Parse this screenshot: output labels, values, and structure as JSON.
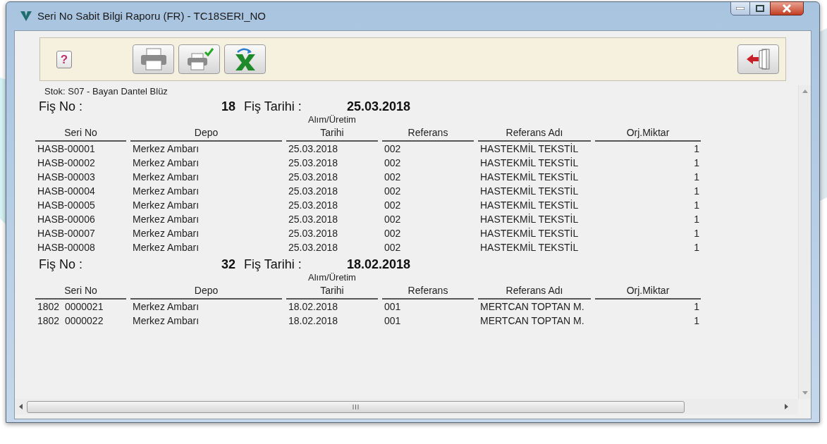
{
  "window": {
    "title": "Seri No Sabit Bilgi Raporu (FR) - TC18SERI_NO"
  },
  "toolbar": [
    {
      "kind": "help",
      "label": "?"
    },
    {
      "kind": "print"
    },
    {
      "kind": "print-check"
    },
    {
      "kind": "excel"
    },
    {
      "kind": "exit"
    }
  ],
  "report": {
    "stock": "Stok: S07 - Bayan Dantel Blüz",
    "groups": [
      {
        "fis_no_label": "Fiş No :",
        "fis_no": "18",
        "fis_tarihi_label": "Fiş Tarihi :",
        "fis_tarihi": "25.03.2018",
        "columns": [
          {
            "label": "Seri No",
            "kind": "text"
          },
          {
            "label": "Depo",
            "kind": "text"
          },
          {
            "over": "Alım/Üretim",
            "label": "Tarihi",
            "kind": "text"
          },
          {
            "label": "Referans",
            "kind": "text"
          },
          {
            "label": "Referans Adı",
            "kind": "text"
          },
          {
            "label": "Orj.Miktar",
            "kind": "number"
          }
        ],
        "rows": [
          [
            "HASB-00001",
            "Merkez Ambarı",
            "25.03.2018",
            "002",
            "HASTEKMİL TEKSTİL",
            "1"
          ],
          [
            "HASB-00002",
            "Merkez Ambarı",
            "25.03.2018",
            "002",
            "HASTEKMİL TEKSTİL",
            "1"
          ],
          [
            "HASB-00003",
            "Merkez Ambarı",
            "25.03.2018",
            "002",
            "HASTEKMİL TEKSTİL",
            "1"
          ],
          [
            "HASB-00004",
            "Merkez Ambarı",
            "25.03.2018",
            "002",
            "HASTEKMİL TEKSTİL",
            "1"
          ],
          [
            "HASB-00005",
            "Merkez Ambarı",
            "25.03.2018",
            "002",
            "HASTEKMİL TEKSTİL",
            "1"
          ],
          [
            "HASB-00006",
            "Merkez Ambarı",
            "25.03.2018",
            "002",
            "HASTEKMİL TEKSTİL",
            "1"
          ],
          [
            "HASB-00007",
            "Merkez Ambarı",
            "25.03.2018",
            "002",
            "HASTEKMİL TEKSTİL",
            "1"
          ],
          [
            "HASB-00008",
            "Merkez Ambarı",
            "25.03.2018",
            "002",
            "HASTEKMİL TEKSTİL",
            "1"
          ]
        ]
      },
      {
        "fis_no_label": "Fiş No :",
        "fis_no": "32",
        "fis_tarihi_label": "Fiş Tarihi :",
        "fis_tarihi": "18.02.2018",
        "columns": [
          {
            "label": "Seri No",
            "kind": "text"
          },
          {
            "label": "Depo",
            "kind": "text"
          },
          {
            "over": "Alım/Üretim",
            "label": "Tarihi",
            "kind": "text"
          },
          {
            "label": "Referans",
            "kind": "text"
          },
          {
            "label": "Referans Adı",
            "kind": "text"
          },
          {
            "label": "Orj.Miktar",
            "kind": "number"
          }
        ],
        "rows": [
          [
            "1802  0000021",
            "Merkez Ambarı",
            "18.02.2018",
            "001",
            "MERTCAN TOPTAN M.",
            "1"
          ],
          [
            "1802  0000022",
            "Merkez Ambarı",
            "18.02.2018",
            "001",
            "MERTCAN TOPTAN M.",
            "1"
          ]
        ]
      }
    ]
  }
}
